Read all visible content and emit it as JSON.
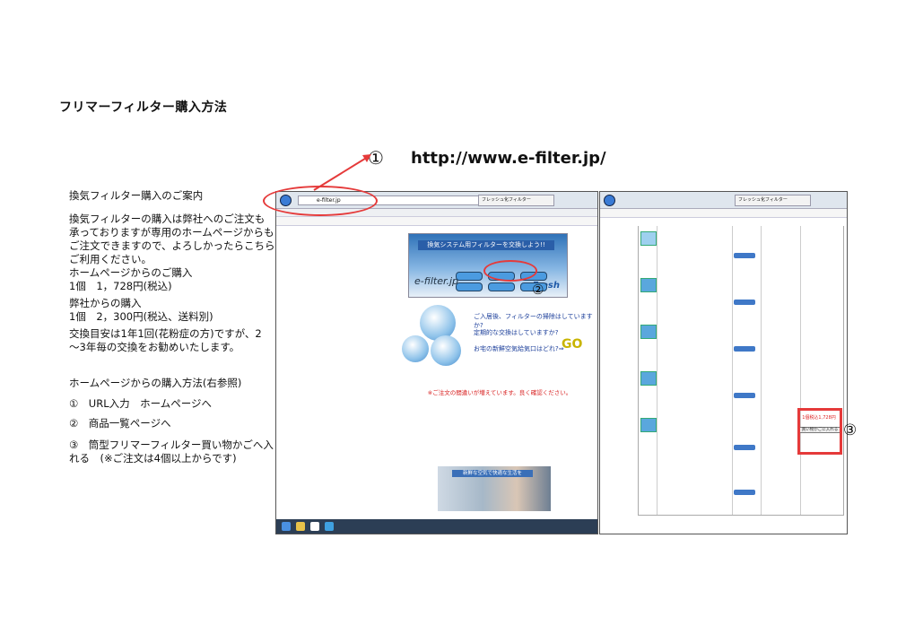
{
  "title": "フリマーフィルター購入方法",
  "callout": {
    "num": "①",
    "url": "http://www.e-filter.jp/"
  },
  "marker2": "②",
  "marker3": "③",
  "left": {
    "heading": "換気フィルター購入のご案内",
    "intro": [
      "換気フィルターの購入は弊社へのご注文も",
      "承っておりますが専用のホームページからも",
      "ご注文できますので、よろしかったらこちらを",
      "ご利用ください。"
    ],
    "hp_label": "ホームページからのご購入",
    "hp_price": "1個　1，728円(税込)",
    "co_label": "弊社からの購入",
    "co_price": "1個　2，300円(税込、送料別)",
    "exchange": [
      "交換目安は1年1回(花粉症の方)ですが、2",
      "～3年毎の交換をお勧めいたします。"
    ],
    "steps_heading": "ホームページからの購入方法(右参照)",
    "step1": "①　URL入力　ホームページへ",
    "step2": "②　商品一覧ページへ",
    "step3": [
      "③　筒型フリマーフィルター買い物かごへ入",
      "れる　(※ご注文は4個以上からです)"
    ]
  },
  "screen1": {
    "address": "e-filter.jp",
    "tab": "フレッシュ化フィルター",
    "banner_caption": "換気システム用フィルターを交換しよう!!",
    "logo": "e-filter.jp",
    "fresh": "Fresh",
    "q1": "ご入居後、フィルターの掃除はしていますか?",
    "q2": "定期的な交換はしていますか?",
    "q3": "お宅の新鮮空気給気口はどれ?⇒",
    "go": "GO",
    "warning": "※ご注文の間違いが増えています。良く確認ください。",
    "photo_caption": "新鮮な空気で快適な生活を"
  },
  "screen2": {
    "tab": "フレッシュ化フィルター",
    "price_tag": "1個税込1,728円",
    "cart": "買い物かごに入れる"
  }
}
